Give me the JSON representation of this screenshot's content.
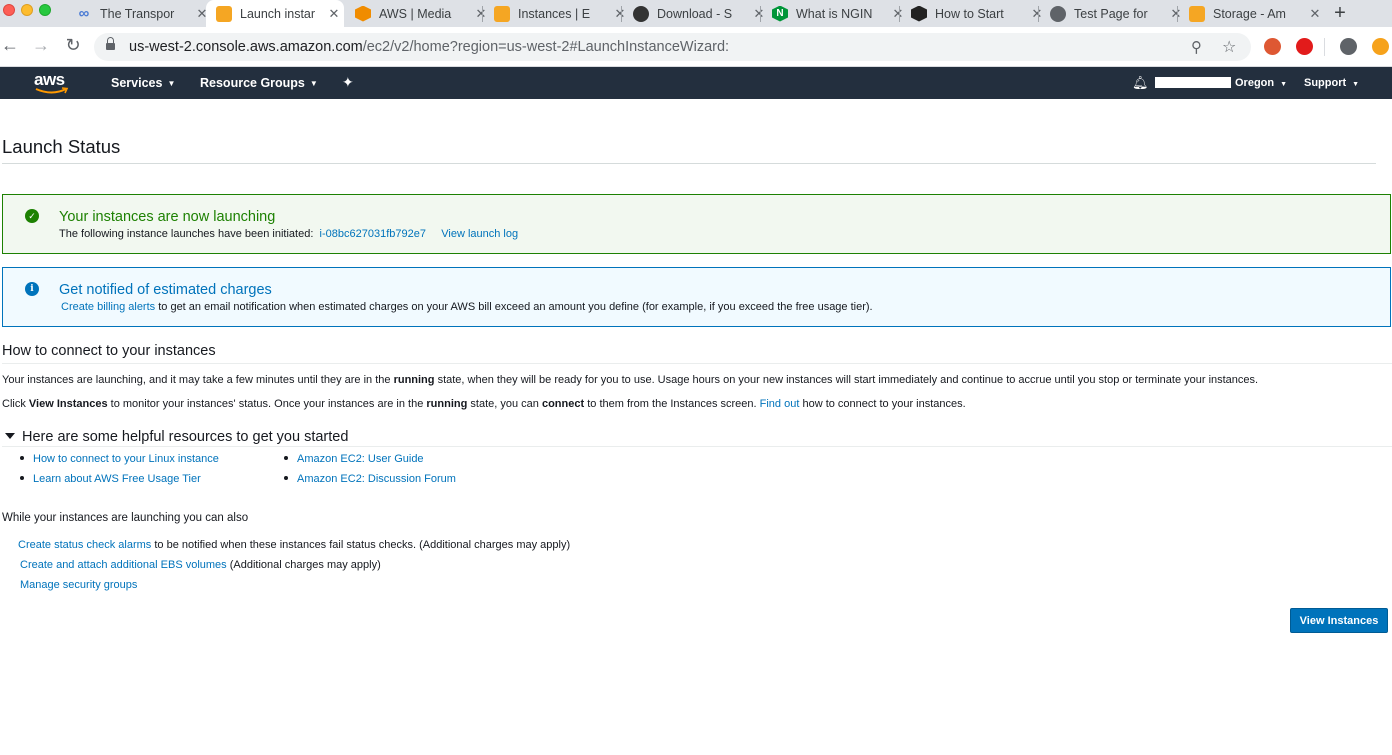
{
  "browser": {
    "tabs": [
      {
        "title": "The Transpor",
        "icon": "infinity-icon",
        "color": "#4a7bd4"
      },
      {
        "title": "Launch instar",
        "icon": "aws-box-icon",
        "color": "#f5a623",
        "active": true
      },
      {
        "title": "AWS | Media",
        "icon": "aws-media-icon",
        "color": "#f08c00"
      },
      {
        "title": "Instances | E",
        "icon": "aws-box-icon",
        "color": "#f5a623"
      },
      {
        "title": "Download - S",
        "icon": "download-icon",
        "color": "#333333"
      },
      {
        "title": "What is NGIN",
        "icon": "nginx-icon",
        "color": "#009639"
      },
      {
        "title": "How to Start",
        "icon": "hexagon-icon",
        "color": "#222222"
      },
      {
        "title": "Test Page for",
        "icon": "globe-icon",
        "color": "#5f6368"
      },
      {
        "title": "Storage - Am",
        "icon": "storage-icon",
        "color": "#f5a623"
      }
    ],
    "url_host": "us-west-2.console.aws.amazon.com",
    "url_path": "/ec2/v2/home?region=us-west-2#LaunchInstanceWizard:"
  },
  "awsnav": {
    "logo": "aws",
    "services": "Services",
    "resource_groups": "Resource Groups",
    "region": "Oregon",
    "support": "Support"
  },
  "page": {
    "title": "Launch Status",
    "success": {
      "heading": "Your instances are now launching",
      "text": "The following instance launches have been initiated:",
      "instance_id": "i-08bc627031fb792e7",
      "log_link": "View launch log"
    },
    "info": {
      "heading": "Get notified of estimated charges",
      "link": "Create billing alerts",
      "text": "to get an email notification when estimated charges on your AWS bill exceed an amount you define (for example, if you exceed the free usage tier)."
    },
    "connect": {
      "heading": "How to connect to your instances",
      "p1_a": "Your instances are launching, and it may take a few minutes until they are in the",
      "p1_b": "running",
      "p1_c": "state, when they will be ready for you to use. Usage hours on your new instances will start immediately and continue to accrue until you stop or terminate your instances.",
      "p2_a": "Click",
      "p2_b": "View Instances",
      "p2_c": "to monitor your instances' status. Once your instances are in the",
      "p2_d": "running",
      "p2_e": "state, you can",
      "p2_f": "connect",
      "p2_g": "to them from the Instances screen.",
      "p2_link": "Find out",
      "p2_h": "how to connect to your instances."
    },
    "resources": {
      "heading": "Here are some helpful resources to get you started",
      "items": [
        "How to connect to your Linux instance",
        "Learn about AWS Free Usage Tier",
        "Amazon EC2: User Guide",
        "Amazon EC2: Discussion Forum"
      ]
    },
    "also": {
      "heading": "While your instances are launching you can also",
      "status_link": "Create status check alarms",
      "status_text": "to be notified when these instances fail status checks. (Additional charges may apply)",
      "ebs_link": "Create and attach additional EBS volumes",
      "ebs_text": "(Additional charges may apply)",
      "sg_link": "Manage security groups"
    },
    "view_instances": "View Instances"
  }
}
